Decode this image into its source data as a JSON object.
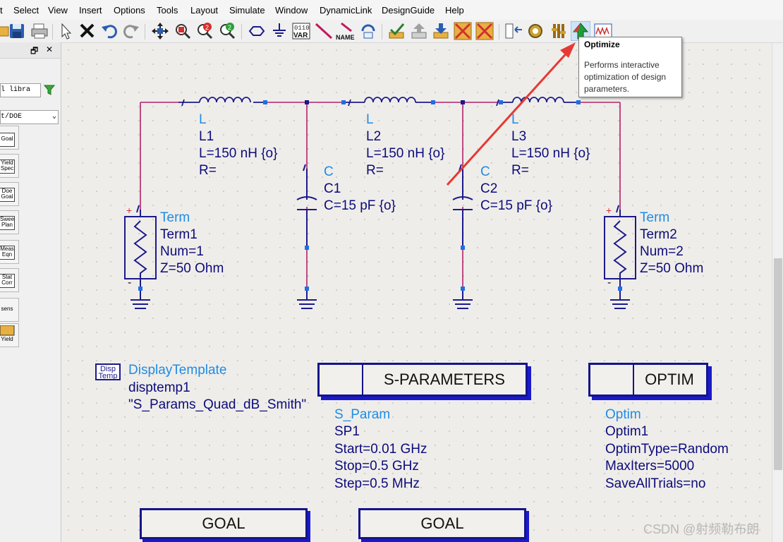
{
  "menubar": {
    "items": [
      "t",
      "Select",
      "View",
      "Insert",
      "Options",
      "Tools",
      "Layout",
      "Simulate",
      "Window",
      "DynamicLink",
      "DesignGuide",
      "Help"
    ]
  },
  "toolbar": {
    "var_label": "VAR",
    "var_bits": "0110",
    "name_label": "NAME"
  },
  "left_panel": {
    "restore_glyph": "🗗",
    "close_glyph": "✕",
    "library_search": "l libra",
    "palette_select": "t/DOE",
    "palette_items": [
      "Goal",
      "Yield Spec",
      "Doe Goal",
      "Sweep Plan",
      "Meas Eqn",
      "Stat Corr",
      "sens",
      "Yield"
    ]
  },
  "schematic": {
    "inductors": [
      {
        "type": "L",
        "name": "L1",
        "value": "L=150 nH {o}",
        "r": "R="
      },
      {
        "type": "L",
        "name": "L2",
        "value": "L=150 nH {o}",
        "r": "R="
      },
      {
        "type": "L",
        "name": "L3",
        "value": "L=150 nH {o}",
        "r": "R="
      }
    ],
    "capacitors": [
      {
        "type": "C",
        "name": "C1",
        "value": "C=15 pF {o}"
      },
      {
        "type": "C",
        "name": "C2",
        "value": "C=15 pF {o}"
      }
    ],
    "terms": [
      {
        "type": "Term",
        "name": "Term1",
        "num": "Num=1",
        "z": "Z=50 Ohm"
      },
      {
        "type": "Term",
        "name": "Term2",
        "num": "Num=2",
        "z": "Z=50 Ohm"
      }
    ],
    "display_template": {
      "icon_line1": "Disp",
      "icon_line2": "Temp",
      "type": "DisplayTemplate",
      "name": "disptemp1",
      "value": "\"S_Params_Quad_dB_Smith\""
    },
    "sparam": {
      "title": "S-PARAMETERS",
      "type": "S_Param",
      "name": "SP1",
      "start": "Start=0.01 GHz",
      "stop": "Stop=0.5 GHz",
      "step": "Step=0.5 MHz"
    },
    "optim": {
      "title": "OPTIM",
      "type": "Optim",
      "name": "Optim1",
      "optim_type": "OptimType=Random",
      "max_iters": "MaxIters=5000",
      "save_all": "SaveAllTrials=no"
    },
    "goals": [
      "GOAL",
      "GOAL"
    ]
  },
  "tooltip": {
    "title": "Optimize",
    "body": "Performs interactive optimization of design parameters."
  },
  "watermark": "CSDN @射频勒布朗",
  "colors": {
    "wire": "#b0206a",
    "component": "#1a1a8c",
    "label_type": "#1e8ce6",
    "label_param": "#0b0b7c",
    "annotation_arrow": "#e53935"
  }
}
